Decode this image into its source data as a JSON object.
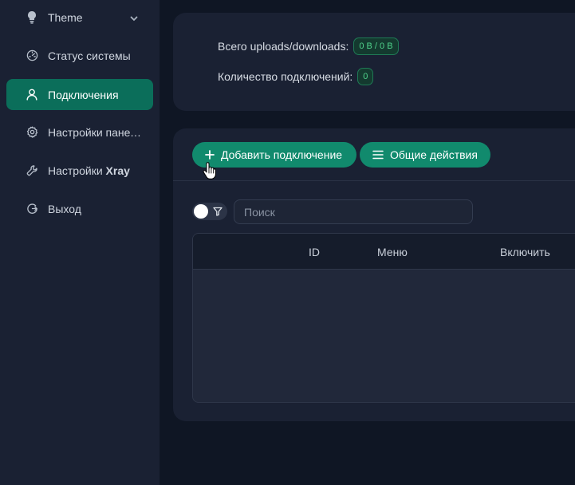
{
  "sidebar": {
    "items": [
      {
        "label": "Theme",
        "icon": "bulb-icon"
      },
      {
        "label": "Статус системы",
        "icon": "dashboard-icon"
      },
      {
        "label": "Подключения",
        "icon": "user-icon",
        "active": true
      },
      {
        "label": "Настройки панели",
        "icon": "gear-icon"
      },
      {
        "label_prefix": "Настройки ",
        "label_bold": "Xray",
        "icon": "tool-icon"
      },
      {
        "label": "Выход",
        "icon": "logout-icon"
      }
    ]
  },
  "stats": {
    "total_label": "Всего uploads/downloads:",
    "total_value": "0 B / 0 B",
    "count_label": "Количество подключений:",
    "count_value": "0"
  },
  "toolbar": {
    "add_label": "Добавить подключение",
    "actions_label": "Общие действия"
  },
  "search": {
    "placeholder": "Поиск",
    "value": ""
  },
  "table": {
    "columns": [
      "ID",
      "Меню",
      "Включить"
    ]
  },
  "colors": {
    "accent": "#118a6d",
    "active_item": "#0b6e5a",
    "background": "#0f1624",
    "card": "#1a2133",
    "tag_text": "#4fd18b"
  }
}
